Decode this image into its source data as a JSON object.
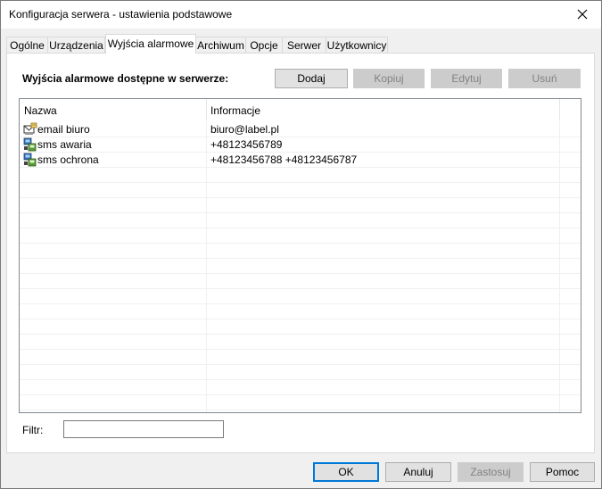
{
  "window": {
    "title": "Konfiguracja serwera - ustawienia podstawowe"
  },
  "tabs": [
    {
      "label": "Ogólne"
    },
    {
      "label": "Urządzenia"
    },
    {
      "label": "Wyjścia alarmowe"
    },
    {
      "label": "Archiwum"
    },
    {
      "label": "Opcje"
    },
    {
      "label": "Serwer"
    },
    {
      "label": "Użytkownicy"
    }
  ],
  "active_tab": "Wyjścia alarmowe",
  "section": {
    "label": "Wyjścia alarmowe dostępne w serwerze:",
    "buttons": {
      "add": "Dodaj",
      "copy": "Kopiuj",
      "edit": "Edytuj",
      "delete": "Usuń"
    }
  },
  "list": {
    "columns": [
      "Nazwa",
      "Informacje"
    ],
    "rows": [
      {
        "name": "email biuro",
        "info": "biuro@label.pl",
        "icon": "email-output-icon"
      },
      {
        "name": "sms awaria",
        "info": "+48123456789",
        "icon": "sms-output-icon"
      },
      {
        "name": "sms ochrona",
        "info": "+48123456788 +48123456787",
        "icon": "sms-output-icon"
      }
    ]
  },
  "filter": {
    "label": "Filtr:",
    "value": ""
  },
  "footer": {
    "ok": "OK",
    "cancel": "Anuluj",
    "apply": "Zastosuj",
    "help": "Pomoc"
  }
}
